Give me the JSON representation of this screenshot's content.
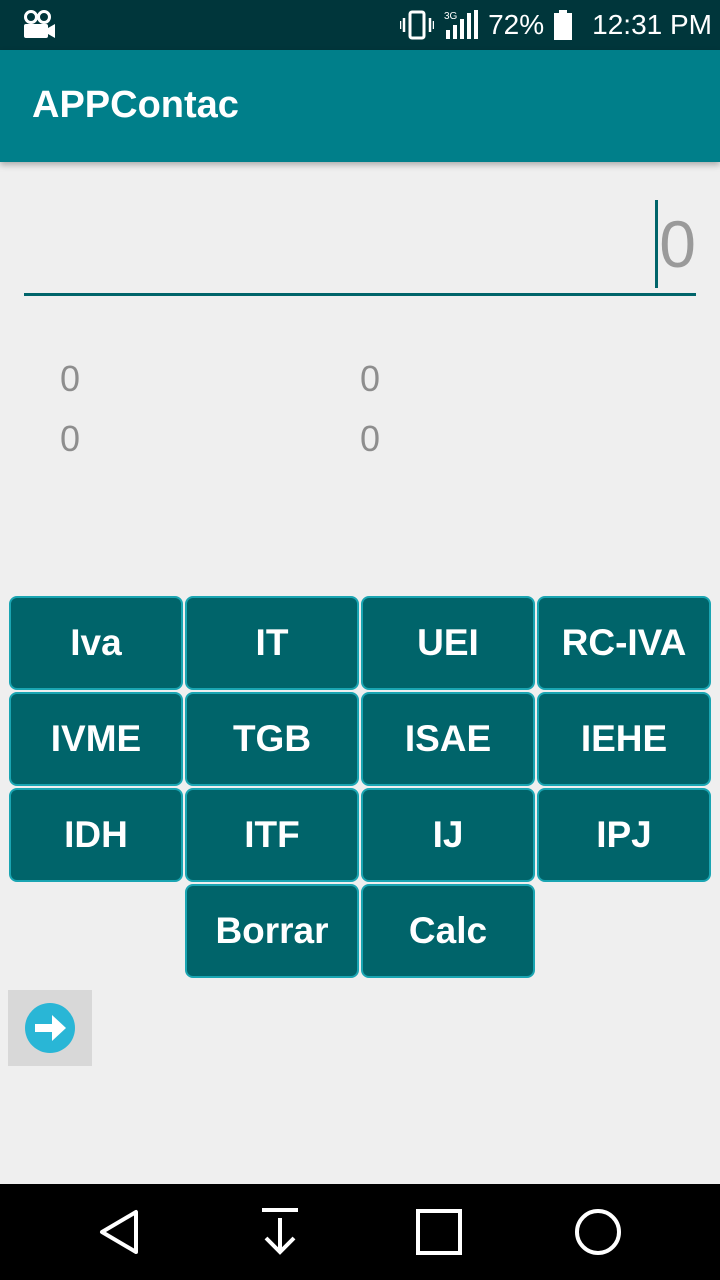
{
  "status_bar": {
    "network_label": "3G",
    "battery": "72%",
    "time": "12:31 PM"
  },
  "app_bar": {
    "title": "APPContac"
  },
  "amount_input": {
    "placeholder": "0"
  },
  "results": {
    "row1_left": "0",
    "row1_right": "0",
    "row2_left": "0",
    "row2_right": "0"
  },
  "buttons": {
    "iva": "Iva",
    "it": "IT",
    "uei": "UEI",
    "rc_iva": "RC-IVA",
    "ivme": "IVME",
    "tgb": "TGB",
    "isae": "ISAE",
    "iehe": "IEHE",
    "idh": "IDH",
    "itf": "ITF",
    "ij": "IJ",
    "ipj": "IPJ",
    "borrar": "Borrar",
    "calc": "Calc"
  },
  "colors": {
    "status_bar": "#00363b",
    "app_bar": "#007f8a",
    "button_fill": "#00646a",
    "button_border": "#1aa5b2",
    "next_icon": "#29b6d6"
  }
}
